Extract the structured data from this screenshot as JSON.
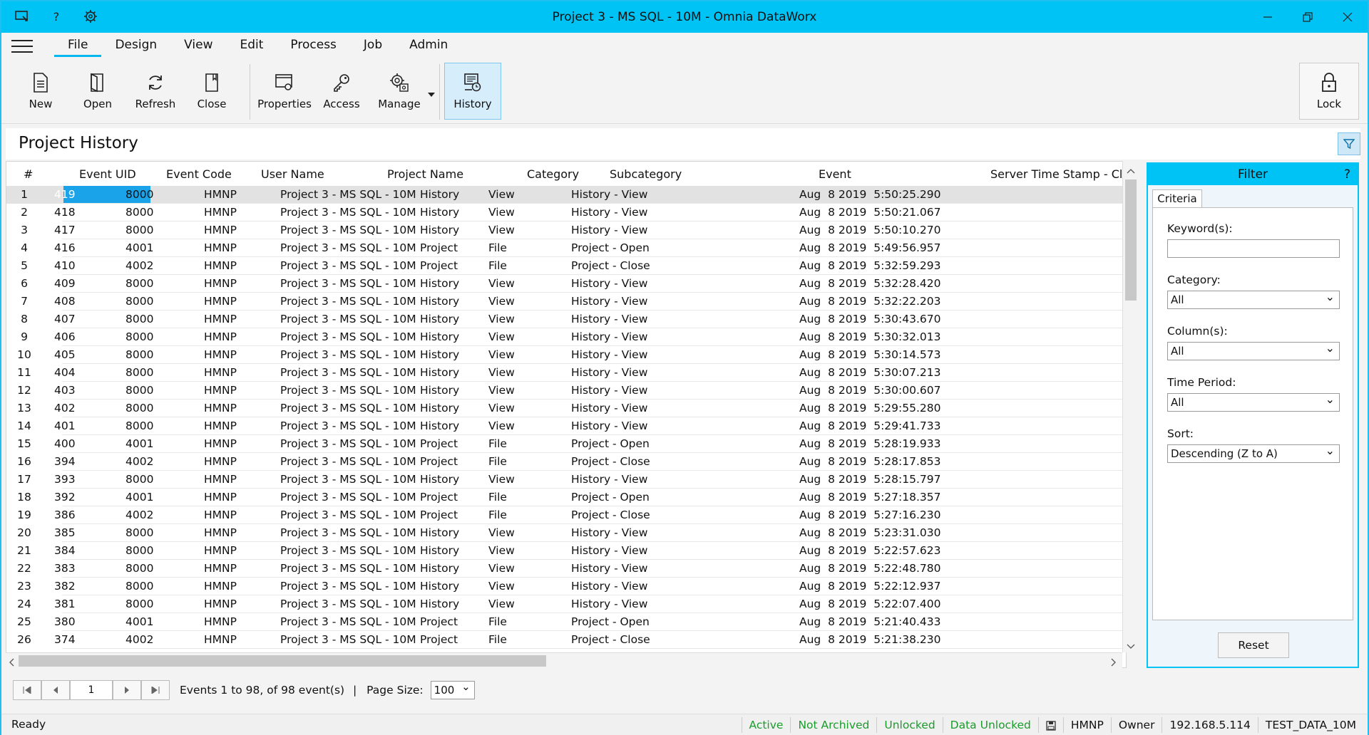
{
  "window": {
    "title": "Project 3 - MS SQL - 10M - Omnia DataWorx",
    "help_glyph": "?"
  },
  "menu": [
    "File",
    "Design",
    "View",
    "Edit",
    "Process",
    "Job",
    "Admin"
  ],
  "ribbon": {
    "new": "New",
    "open": "Open",
    "refresh": "Refresh",
    "close": "Close",
    "properties": "Properties",
    "access": "Access",
    "manage": "Manage",
    "history": "History",
    "lock": "Lock"
  },
  "page_title": "Project History",
  "grid": {
    "headers": {
      "rownum": "#",
      "uid": "Event UID",
      "code": "Event Code",
      "user": "User Name",
      "project": "Project Name",
      "category": "Category",
      "subcategory": "Subcategory",
      "event": "Event",
      "timestamp": "Server Time Stamp - Clie"
    },
    "rows": [
      [
        "1",
        "419",
        "8000",
        "HMNP",
        "Project 3 - MS SQL - 10M",
        "History",
        "View",
        "History - View",
        "Aug  8 2019  5:50:25.290"
      ],
      [
        "2",
        "418",
        "8000",
        "HMNP",
        "Project 3 - MS SQL - 10M",
        "History",
        "View",
        "History - View",
        "Aug  8 2019  5:50:21.067"
      ],
      [
        "3",
        "417",
        "8000",
        "HMNP",
        "Project 3 - MS SQL - 10M",
        "History",
        "View",
        "History - View",
        "Aug  8 2019  5:50:10.270"
      ],
      [
        "4",
        "416",
        "4001",
        "HMNP",
        "Project 3 - MS SQL - 10M",
        "Project",
        "File",
        "Project - Open",
        "Aug  8 2019  5:49:56.957"
      ],
      [
        "5",
        "410",
        "4002",
        "HMNP",
        "Project 3 - MS SQL - 10M",
        "Project",
        "File",
        "Project - Close",
        "Aug  8 2019  5:32:59.293"
      ],
      [
        "6",
        "409",
        "8000",
        "HMNP",
        "Project 3 - MS SQL - 10M",
        "History",
        "View",
        "History - View",
        "Aug  8 2019  5:32:28.420"
      ],
      [
        "7",
        "408",
        "8000",
        "HMNP",
        "Project 3 - MS SQL - 10M",
        "History",
        "View",
        "History - View",
        "Aug  8 2019  5:32:22.203"
      ],
      [
        "8",
        "407",
        "8000",
        "HMNP",
        "Project 3 - MS SQL - 10M",
        "History",
        "View",
        "History - View",
        "Aug  8 2019  5:30:43.670"
      ],
      [
        "9",
        "406",
        "8000",
        "HMNP",
        "Project 3 - MS SQL - 10M",
        "History",
        "View",
        "History - View",
        "Aug  8 2019  5:30:32.013"
      ],
      [
        "10",
        "405",
        "8000",
        "HMNP",
        "Project 3 - MS SQL - 10M",
        "History",
        "View",
        "History - View",
        "Aug  8 2019  5:30:14.573"
      ],
      [
        "11",
        "404",
        "8000",
        "HMNP",
        "Project 3 - MS SQL - 10M",
        "History",
        "View",
        "History - View",
        "Aug  8 2019  5:30:07.213"
      ],
      [
        "12",
        "403",
        "8000",
        "HMNP",
        "Project 3 - MS SQL - 10M",
        "History",
        "View",
        "History - View",
        "Aug  8 2019  5:30:00.607"
      ],
      [
        "13",
        "402",
        "8000",
        "HMNP",
        "Project 3 - MS SQL - 10M",
        "History",
        "View",
        "History - View",
        "Aug  8 2019  5:29:55.280"
      ],
      [
        "14",
        "401",
        "8000",
        "HMNP",
        "Project 3 - MS SQL - 10M",
        "History",
        "View",
        "History - View",
        "Aug  8 2019  5:29:41.733"
      ],
      [
        "15",
        "400",
        "4001",
        "HMNP",
        "Project 3 - MS SQL - 10M",
        "Project",
        "File",
        "Project - Open",
        "Aug  8 2019  5:28:19.933"
      ],
      [
        "16",
        "394",
        "4002",
        "HMNP",
        "Project 3 - MS SQL - 10M",
        "Project",
        "File",
        "Project - Close",
        "Aug  8 2019  5:28:17.853"
      ],
      [
        "17",
        "393",
        "8000",
        "HMNP",
        "Project 3 - MS SQL - 10M",
        "History",
        "View",
        "History - View",
        "Aug  8 2019  5:28:15.797"
      ],
      [
        "18",
        "392",
        "4001",
        "HMNP",
        "Project 3 - MS SQL - 10M",
        "Project",
        "File",
        "Project - Open",
        "Aug  8 2019  5:27:18.357"
      ],
      [
        "19",
        "386",
        "4002",
        "HMNP",
        "Project 3 - MS SQL - 10M",
        "Project",
        "File",
        "Project - Close",
        "Aug  8 2019  5:27:16.230"
      ],
      [
        "20",
        "385",
        "8000",
        "HMNP",
        "Project 3 - MS SQL - 10M",
        "History",
        "View",
        "History - View",
        "Aug  8 2019  5:23:31.030"
      ],
      [
        "21",
        "384",
        "8000",
        "HMNP",
        "Project 3 - MS SQL - 10M",
        "History",
        "View",
        "History - View",
        "Aug  8 2019  5:22:57.623"
      ],
      [
        "22",
        "383",
        "8000",
        "HMNP",
        "Project 3 - MS SQL - 10M",
        "History",
        "View",
        "History - View",
        "Aug  8 2019  5:22:48.780"
      ],
      [
        "23",
        "382",
        "8000",
        "HMNP",
        "Project 3 - MS SQL - 10M",
        "History",
        "View",
        "History - View",
        "Aug  8 2019  5:22:12.937"
      ],
      [
        "24",
        "381",
        "8000",
        "HMNP",
        "Project 3 - MS SQL - 10M",
        "History",
        "View",
        "History - View",
        "Aug  8 2019  5:22:07.400"
      ],
      [
        "25",
        "380",
        "4001",
        "HMNP",
        "Project 3 - MS SQL - 10M",
        "Project",
        "File",
        "Project - Open",
        "Aug  8 2019  5:21:40.433"
      ],
      [
        "26",
        "374",
        "4002",
        "HMNP",
        "Project 3 - MS SQL - 10M",
        "Project",
        "File",
        "Project - Close",
        "Aug  8 2019  5:21:38.230"
      ]
    ]
  },
  "filter": {
    "title": "Filter",
    "help": "?",
    "tab": "Criteria",
    "keywords_label": "Keyword(s):",
    "keywords_value": "",
    "category_label": "Category:",
    "category_value": "All",
    "columns_label": "Column(s):",
    "columns_value": "All",
    "time_label": "Time Period:",
    "time_value": "All",
    "sort_label": "Sort:",
    "sort_value": "Descending (Z to A)",
    "reset": "Reset"
  },
  "pager": {
    "page": "1",
    "info": "Events 1 to 98, of 98 event(s)",
    "separator": "|",
    "size_label": "Page Size:",
    "size_value": "100"
  },
  "status": {
    "ready": "Ready",
    "active": "Active",
    "archived": "Not Archived",
    "unlocked": "Unlocked",
    "data_unlocked": "Data Unlocked",
    "user": "HMNP",
    "role": "Owner",
    "ip": "192.168.5.114",
    "db": "TEST_DATA_10M"
  },
  "colors": {
    "accent": "#00c3f5",
    "selection": "#1aa3e8",
    "status_green": "#1a9c2c"
  }
}
